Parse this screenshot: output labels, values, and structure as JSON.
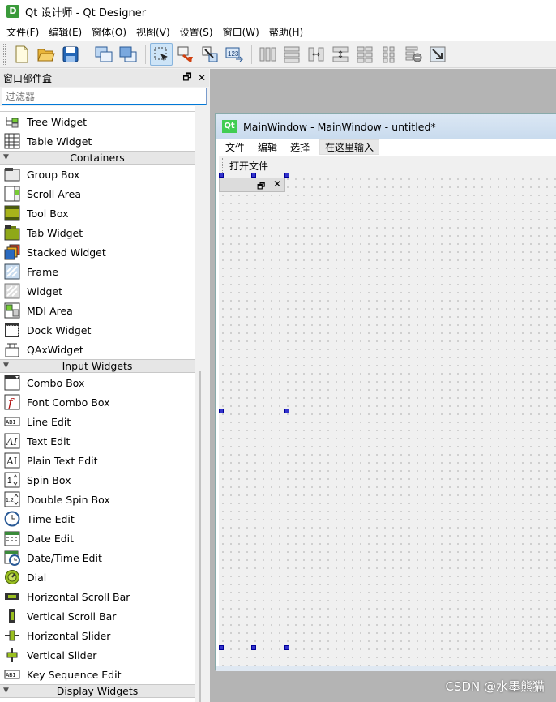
{
  "window": {
    "title": "Qt 设计师 - Qt Designer",
    "icon_letter": "D"
  },
  "menubar": [
    "文件(F)",
    "编辑(E)",
    "窗体(O)",
    "视图(V)",
    "设置(S)",
    "窗口(W)",
    "帮助(H)"
  ],
  "widget_box": {
    "title": "窗口部件盒",
    "float_btn": "🗗",
    "close_btn": "✕",
    "filter_placeholder": "过滤器",
    "items": [
      {
        "kind": "item",
        "label": "Tree Widget",
        "icon": "tree-widget-icon"
      },
      {
        "kind": "item",
        "label": "Table Widget",
        "icon": "table-widget-icon"
      },
      {
        "kind": "category",
        "label": "Containers"
      },
      {
        "kind": "item",
        "label": "Group Box",
        "icon": "group-box-icon"
      },
      {
        "kind": "item",
        "label": "Scroll Area",
        "icon": "scroll-area-icon"
      },
      {
        "kind": "item",
        "label": "Tool Box",
        "icon": "tool-box-icon"
      },
      {
        "kind": "item",
        "label": "Tab Widget",
        "icon": "tab-widget-icon"
      },
      {
        "kind": "item",
        "label": "Stacked Widget",
        "icon": "stacked-widget-icon"
      },
      {
        "kind": "item",
        "label": "Frame",
        "icon": "frame-icon"
      },
      {
        "kind": "item",
        "label": "Widget",
        "icon": "widget-icon"
      },
      {
        "kind": "item",
        "label": "MDI Area",
        "icon": "mdi-area-icon"
      },
      {
        "kind": "item",
        "label": "Dock Widget",
        "icon": "dock-widget-icon"
      },
      {
        "kind": "item",
        "label": "QAxWidget",
        "icon": "qaxwidget-icon"
      },
      {
        "kind": "category",
        "label": "Input Widgets"
      },
      {
        "kind": "item",
        "label": "Combo Box",
        "icon": "combo-box-icon"
      },
      {
        "kind": "item",
        "label": "Font Combo Box",
        "icon": "font-combo-box-icon"
      },
      {
        "kind": "item",
        "label": "Line Edit",
        "icon": "line-edit-icon"
      },
      {
        "kind": "item",
        "label": "Text Edit",
        "icon": "text-edit-icon"
      },
      {
        "kind": "item",
        "label": "Plain Text Edit",
        "icon": "plain-text-edit-icon"
      },
      {
        "kind": "item",
        "label": "Spin Box",
        "icon": "spin-box-icon"
      },
      {
        "kind": "item",
        "label": "Double Spin Box",
        "icon": "double-spin-box-icon"
      },
      {
        "kind": "item",
        "label": "Time Edit",
        "icon": "time-edit-icon"
      },
      {
        "kind": "item",
        "label": "Date Edit",
        "icon": "date-edit-icon"
      },
      {
        "kind": "item",
        "label": "Date/Time Edit",
        "icon": "datetime-edit-icon"
      },
      {
        "kind": "item",
        "label": "Dial",
        "icon": "dial-icon"
      },
      {
        "kind": "item",
        "label": "Horizontal Scroll Bar",
        "icon": "hscrollbar-icon"
      },
      {
        "kind": "item",
        "label": "Vertical Scroll Bar",
        "icon": "vscrollbar-icon"
      },
      {
        "kind": "item",
        "label": "Horizontal Slider",
        "icon": "hslider-icon"
      },
      {
        "kind": "item",
        "label": "Vertical Slider",
        "icon": "vslider-icon"
      },
      {
        "kind": "item",
        "label": "Key Sequence Edit",
        "icon": "key-sequence-edit-icon"
      },
      {
        "kind": "category",
        "label": "Display Widgets"
      }
    ]
  },
  "form": {
    "title": "MainWindow - MainWindow - untitled*",
    "icon_text": "Qt",
    "menus": [
      "文件",
      "编辑",
      "选择"
    ],
    "type_here": "在这里输入",
    "toolbar_action": "打开文件",
    "dock_float_btn": "🗗",
    "dock_close_btn": "✕"
  },
  "watermark": "CSDN @水墨熊猫",
  "colors": {
    "selection": "#cde4f7",
    "handle": "#3333cc",
    "qt_green": "#41cd52"
  }
}
